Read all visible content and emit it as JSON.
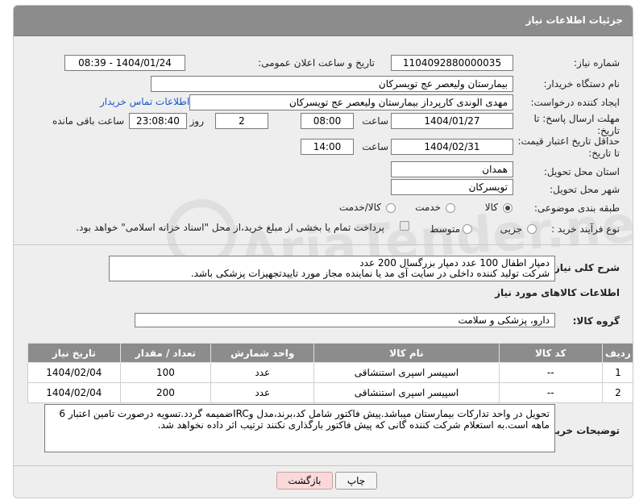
{
  "panel": {
    "title": "جزئیات اطلاعات نیاز"
  },
  "form": {
    "need_number_label": "شماره نیاز:",
    "need_number": "1104092880000035",
    "announce_label": "تاریخ و ساعت اعلان عمومی:",
    "announce_value": "1404/01/24 - 08:39",
    "buyer_org_label": "نام دستگاه خریدار:",
    "buyer_org": "بیمارستان ولیعصر  عج  تویسرکان",
    "creator_label": "ایجاد کننده درخواست:",
    "creator": "مهدی الوندی کارپرداز بیمارستان ولیعصر  عج  تویسرکان",
    "contact_link": "اطلاعات تماس خریدار",
    "send_deadline_label": "مهلت ارسال پاسخ: تا تاریخ:",
    "send_date": "1404/01/27",
    "time_label": "ساعت",
    "send_time": "08:00",
    "days_value": "2",
    "days_label": "روز و",
    "remaining_time": "23:08:40",
    "remaining_label": "ساعت باقی مانده",
    "price_validity_label": "حداقل تاریخ اعتبار قیمت: تا تاریخ:",
    "price_date": "1404/02/31",
    "price_time": "14:00",
    "province_label": "استان محل تحویل:",
    "province": "همدان",
    "city_label": "شهر محل تحویل:",
    "city": "تویسرکان",
    "category_label": "طبقه بندی موضوعی:",
    "category_options": [
      "کالا",
      "خدمت",
      "کالا/خدمت"
    ],
    "category_selected": "کالا",
    "process_label": "نوع فرآیند خرید :",
    "process_options": [
      "جزیی",
      "متوسط"
    ],
    "process_selected": "جزیی",
    "payment_note": "پرداخت تمام یا بخشی از مبلغ خرید،از محل \"اسناد خزانه اسلامی\" خواهد بود."
  },
  "description": {
    "label": "شرح کلی نیاز:",
    "line1": "دمپار اطفال 100 عدد دمپار بزرگسال 200 عدد",
    "line2": "شرکت تولید کننده داخلی در سایت آی مد یا نماینده مجاز مورد تاییدتجهیزات پزشکی باشد."
  },
  "goods_section": {
    "title": "اطلاعات کالاهای مورد نیاز",
    "group_label": "گروه کالا:",
    "group_value": "دارو، پزشکی و سلامت"
  },
  "table": {
    "headers": [
      "ردیف",
      "کد کالا",
      "نام کالا",
      "واحد شمارش",
      "تعداد / مقدار",
      "تاریخ نیاز"
    ],
    "rows": [
      {
        "row": "1",
        "code": "--",
        "name": "اسپیسر اسپری استنشاقی",
        "unit": "عدد",
        "qty": "100",
        "date": "1404/02/04"
      },
      {
        "row": "2",
        "code": "--",
        "name": "اسپیسر اسپری استنشاقی",
        "unit": "عدد",
        "qty": "200",
        "date": "1404/02/04"
      }
    ]
  },
  "buyer_notes": {
    "label": "توضیحات خریدار:",
    "line1": "تحویل در واحد تدارکات بیمارستان میباشد.پیش فاکتور شامل کد،برند،مدل وIRCضمیمه گردد.تسویه درصورت تامین اعتبار 6",
    "line2": "ماهه است.به استعلام شرکت کننده گانی که پیش فاکتور بارگذاری نکنند ترتیب اثر داده نخواهد شد."
  },
  "buttons": {
    "print": "چاپ",
    "back": "بازگشت"
  },
  "watermark": {
    "text": "AriaTender.neT"
  }
}
